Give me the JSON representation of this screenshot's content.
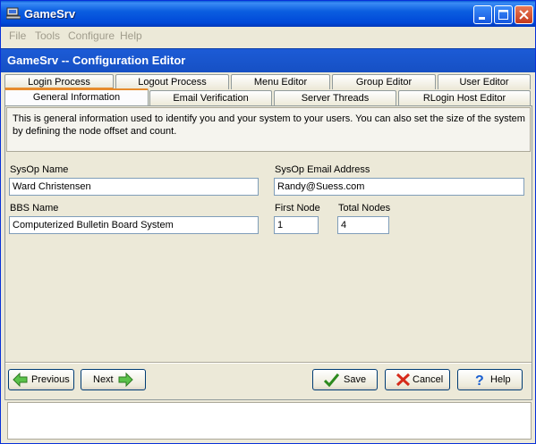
{
  "window": {
    "title": "GameSrv"
  },
  "menu": [
    "File",
    "Tools",
    "Configure",
    "Help"
  ],
  "header": {
    "title": "GameSrv -- Configuration Editor"
  },
  "tabs_row1": [
    "Login Process",
    "Logout Process",
    "Menu Editor",
    "Group Editor",
    "User Editor"
  ],
  "tabs_row2": [
    "General Information",
    "Email Verification",
    "Server Threads",
    "RLogin Host Editor"
  ],
  "info": "This is general information used to identify you and your system to your users.  You can also set the size of the system by defining the node offset and count.",
  "form": {
    "sysop_name_label": "SysOp Name",
    "sysop_name": "Ward Christensen",
    "sysop_email_label": "SysOp Email Address",
    "sysop_email": "Randy@Suess.com",
    "bbs_name_label": "BBS Name",
    "bbs_name": "Computerized Bulletin Board System",
    "first_node_label": "First Node",
    "first_node": "1",
    "total_nodes_label": "Total Nodes",
    "total_nodes": "4"
  },
  "buttons": {
    "previous": "Previous",
    "next": "Next",
    "save": "Save",
    "cancel": "Cancel",
    "help": "Help"
  },
  "icons": {
    "app": "computer-icon",
    "previous": "green-arrow-left-icon",
    "next": "green-arrow-right-icon",
    "save": "green-checkmark-icon",
    "cancel": "red-x-icon",
    "help": "question-mark-icon"
  },
  "colors": {
    "title_bar": "#0b5ee0",
    "header": "#1c5bd6",
    "active_tab_accent": "#e68b2c"
  }
}
